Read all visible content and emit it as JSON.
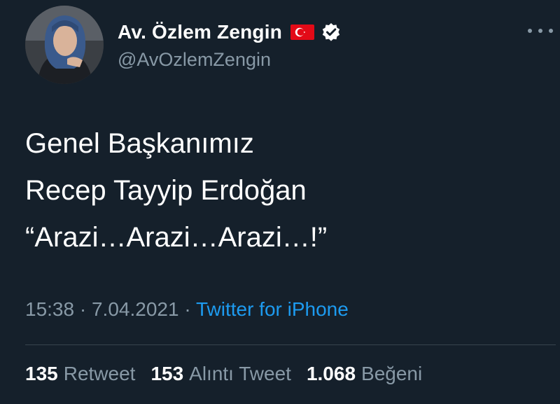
{
  "user": {
    "display_name": "Av. Özlem Zengin",
    "handle": "@AvOzlemZengin",
    "flag_icon": "turkey-flag-icon",
    "verified_icon": "verified-badge-icon"
  },
  "tweet": {
    "lines": [
      "Genel Başkanımız",
      "Recep Tayyip Erdoğan",
      "“Arazi…Arazi…Arazi…!”"
    ],
    "time": "15:38",
    "separator": "·",
    "date": "7.04.2021",
    "source": "Twitter for iPhone"
  },
  "stats": {
    "retweets": {
      "count": "135",
      "label": "Retweet"
    },
    "quotes": {
      "count": "153",
      "label": "Alıntı Tweet"
    },
    "likes": {
      "count": "1.068",
      "label": "Beğeni"
    }
  },
  "colors": {
    "background": "#15202b",
    "secondary_text": "#8899a6",
    "link": "#1d9bf0",
    "divider": "#38444d"
  }
}
